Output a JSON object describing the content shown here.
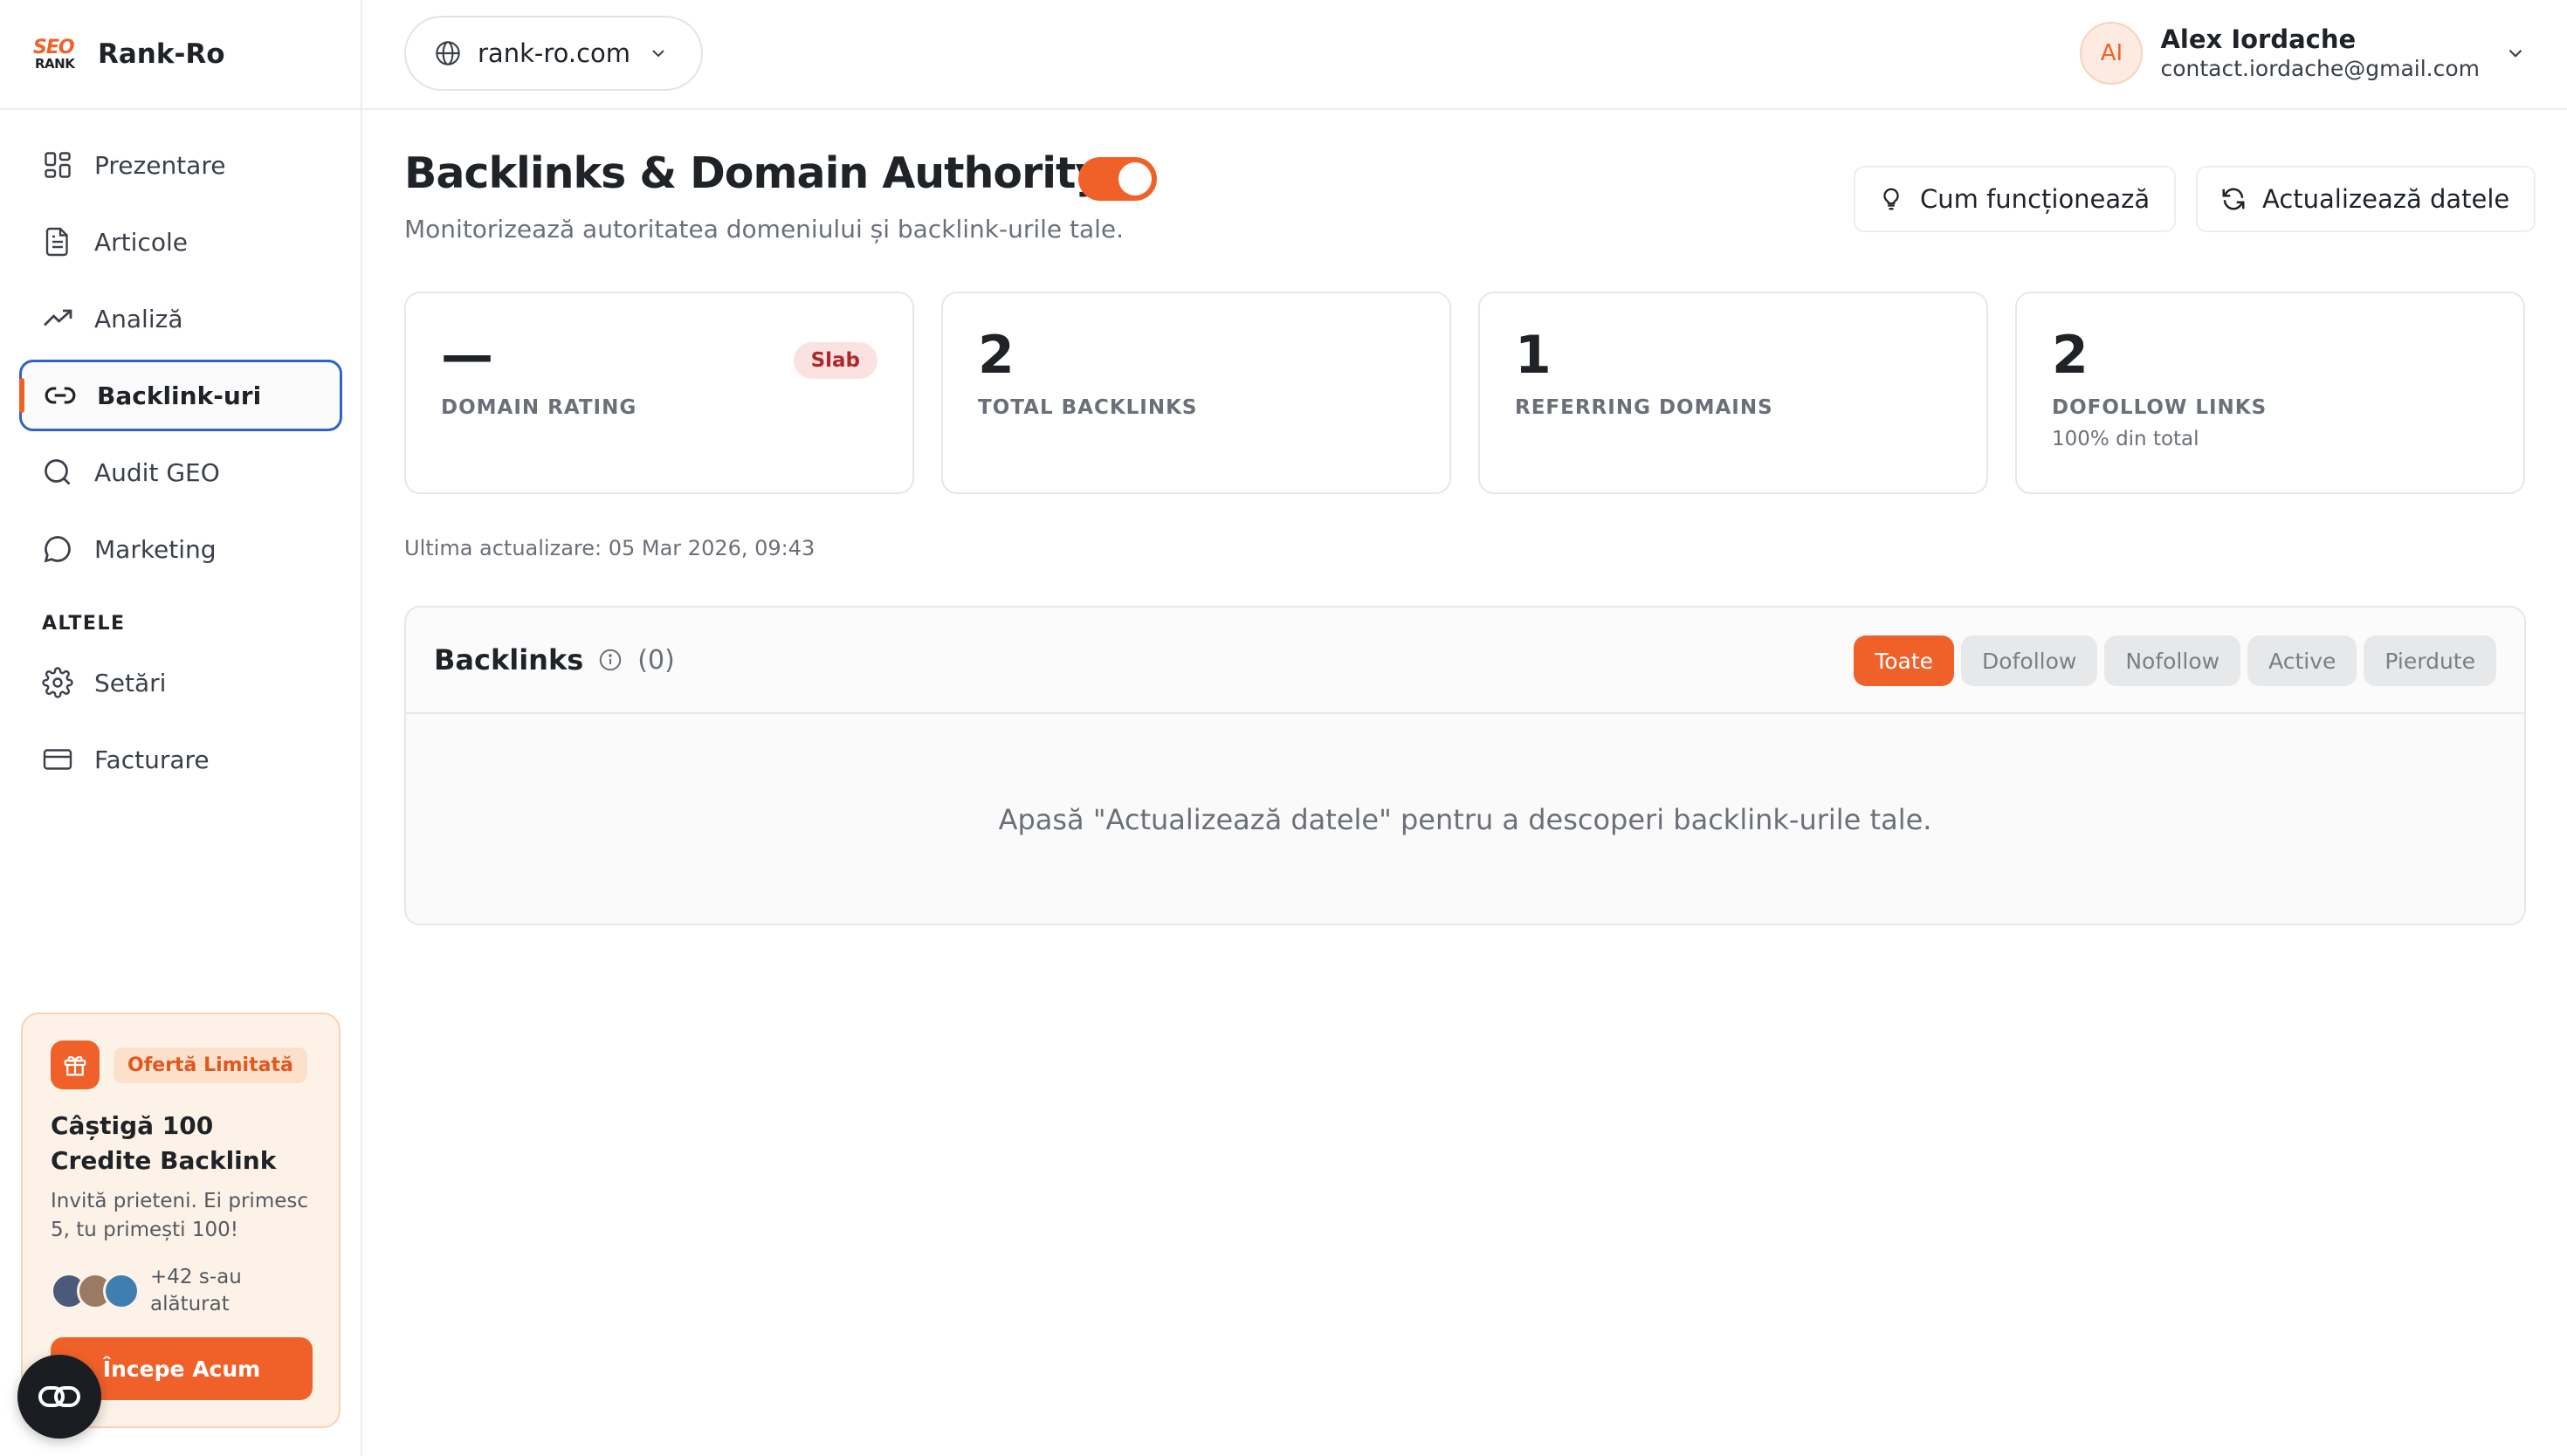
{
  "brand": {
    "logo_top": "SEO",
    "logo_bottom": "RANK",
    "name": "Rank-Ro"
  },
  "sidebar": {
    "items": [
      {
        "label": "Prezentare",
        "icon": "grid-icon"
      },
      {
        "label": "Articole",
        "icon": "document-icon"
      },
      {
        "label": "Analiză",
        "icon": "trend-icon"
      },
      {
        "label": "Backlink-uri",
        "icon": "link-icon",
        "active": true
      },
      {
        "label": "Audit GEO",
        "icon": "search-icon"
      },
      {
        "label": "Marketing",
        "icon": "chat-icon"
      }
    ],
    "section_other": "ALTELE",
    "other_items": [
      {
        "label": "Setări",
        "icon": "gear-icon"
      },
      {
        "label": "Facturare",
        "icon": "card-icon"
      }
    ]
  },
  "promo": {
    "badge": "Ofertă Limitată",
    "title": "Câștigă 100 Credite Backlink",
    "text": "Invită prieteni. Ei primesc 5, tu primești 100!",
    "joined": "+42 s-au alăturat",
    "button": "Începe Acum"
  },
  "topbar": {
    "domain": "rank-ro.com",
    "user": {
      "initials": "AI",
      "name": "Alex Iordache",
      "email": "contact.iordache@gmail.com"
    }
  },
  "page": {
    "title": "Backlinks & Domain Authority",
    "subtitle": "Monitorizează autoritatea domeniului și backlink-urile tale.",
    "how_button": "Cum funcționează",
    "refresh_button": "Actualizează datele",
    "toggle_on": true
  },
  "cards": [
    {
      "value": "—",
      "label": "DOMAIN RATING",
      "badge": "Slab"
    },
    {
      "value": "2",
      "label": "TOTAL BACKLINKS"
    },
    {
      "value": "1",
      "label": "REFERRING DOMAINS"
    },
    {
      "value": "2",
      "label": "DOFOLLOW LINKS",
      "note": "100% din total"
    }
  ],
  "last_updated": "Ultima actualizare: 05 Mar 2026, 09:43",
  "backlinks_panel": {
    "title": "Backlinks",
    "count": "(0)",
    "filters": [
      "Toate",
      "Dofollow",
      "Nofollow",
      "Active",
      "Pierdute"
    ],
    "active_filter": "Toate",
    "empty_message": "Apasă \"Actualizează datele\" pentru a descoperi backlink-urile tale."
  },
  "colors": {
    "accent": "#f0612a",
    "active_border": "#2e64c7",
    "badge_bad_bg": "#fbe2e2",
    "badge_bad_text": "#b42626"
  }
}
